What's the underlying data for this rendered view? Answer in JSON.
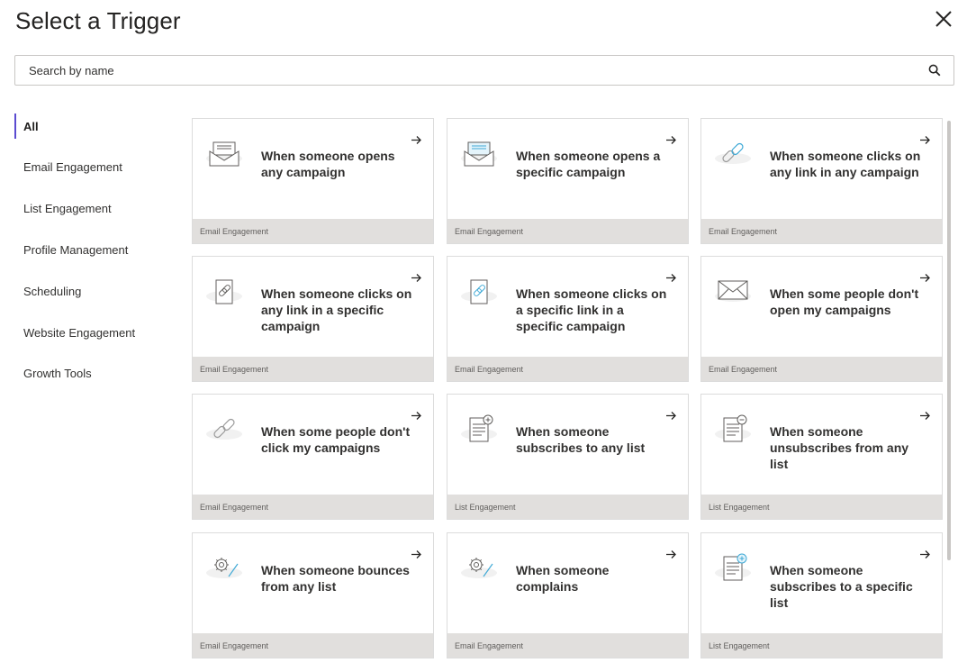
{
  "header": {
    "title": "Select a Trigger"
  },
  "search": {
    "placeholder": "Search by name",
    "value": ""
  },
  "sidebar": {
    "items": [
      {
        "label": "All",
        "active": true
      },
      {
        "label": "Email Engagement"
      },
      {
        "label": "List Engagement"
      },
      {
        "label": "Profile Management"
      },
      {
        "label": "Scheduling"
      },
      {
        "label": "Website Engagement"
      },
      {
        "label": "Growth Tools"
      }
    ]
  },
  "cards": [
    {
      "title": "When someone opens any campaign",
      "category": "Email Engagement",
      "icon": "envelope-open-icon"
    },
    {
      "title": "When someone opens a specific campaign",
      "category": "Email Engagement",
      "icon": "envelope-open-specific-icon"
    },
    {
      "title": "When someone clicks on any link in any campaign",
      "category": "Email Engagement",
      "icon": "link-icon"
    },
    {
      "title": "When someone clicks on any link in a specific campaign",
      "category": "Email Engagement",
      "icon": "document-link-icon"
    },
    {
      "title": "When someone clicks on a specific link in a specific campaign",
      "category": "Email Engagement",
      "icon": "document-link-specific-icon"
    },
    {
      "title": "When some people don't open my campaigns",
      "category": "Email Engagement",
      "icon": "envelope-closed-icon"
    },
    {
      "title": "When some people don't click my campaigns",
      "category": "Email Engagement",
      "icon": "link-unclicked-icon"
    },
    {
      "title": "When someone subscribes to any list",
      "category": "List Engagement",
      "icon": "list-add-icon"
    },
    {
      "title": "When someone unsubscribes from any list",
      "category": "List Engagement",
      "icon": "list-remove-icon"
    },
    {
      "title": "When someone bounces from any list",
      "category": "Email Engagement",
      "icon": "gear-bounce-icon"
    },
    {
      "title": "When someone complains",
      "category": "Email Engagement",
      "icon": "gear-complaint-icon"
    },
    {
      "title": "When someone subscribes to a specific list",
      "category": "List Engagement",
      "icon": "list-add-specific-icon"
    }
  ],
  "colors": {
    "accent": "#5b4bd0",
    "footer": "#e1dfdd",
    "border": "#dcdcdc"
  }
}
